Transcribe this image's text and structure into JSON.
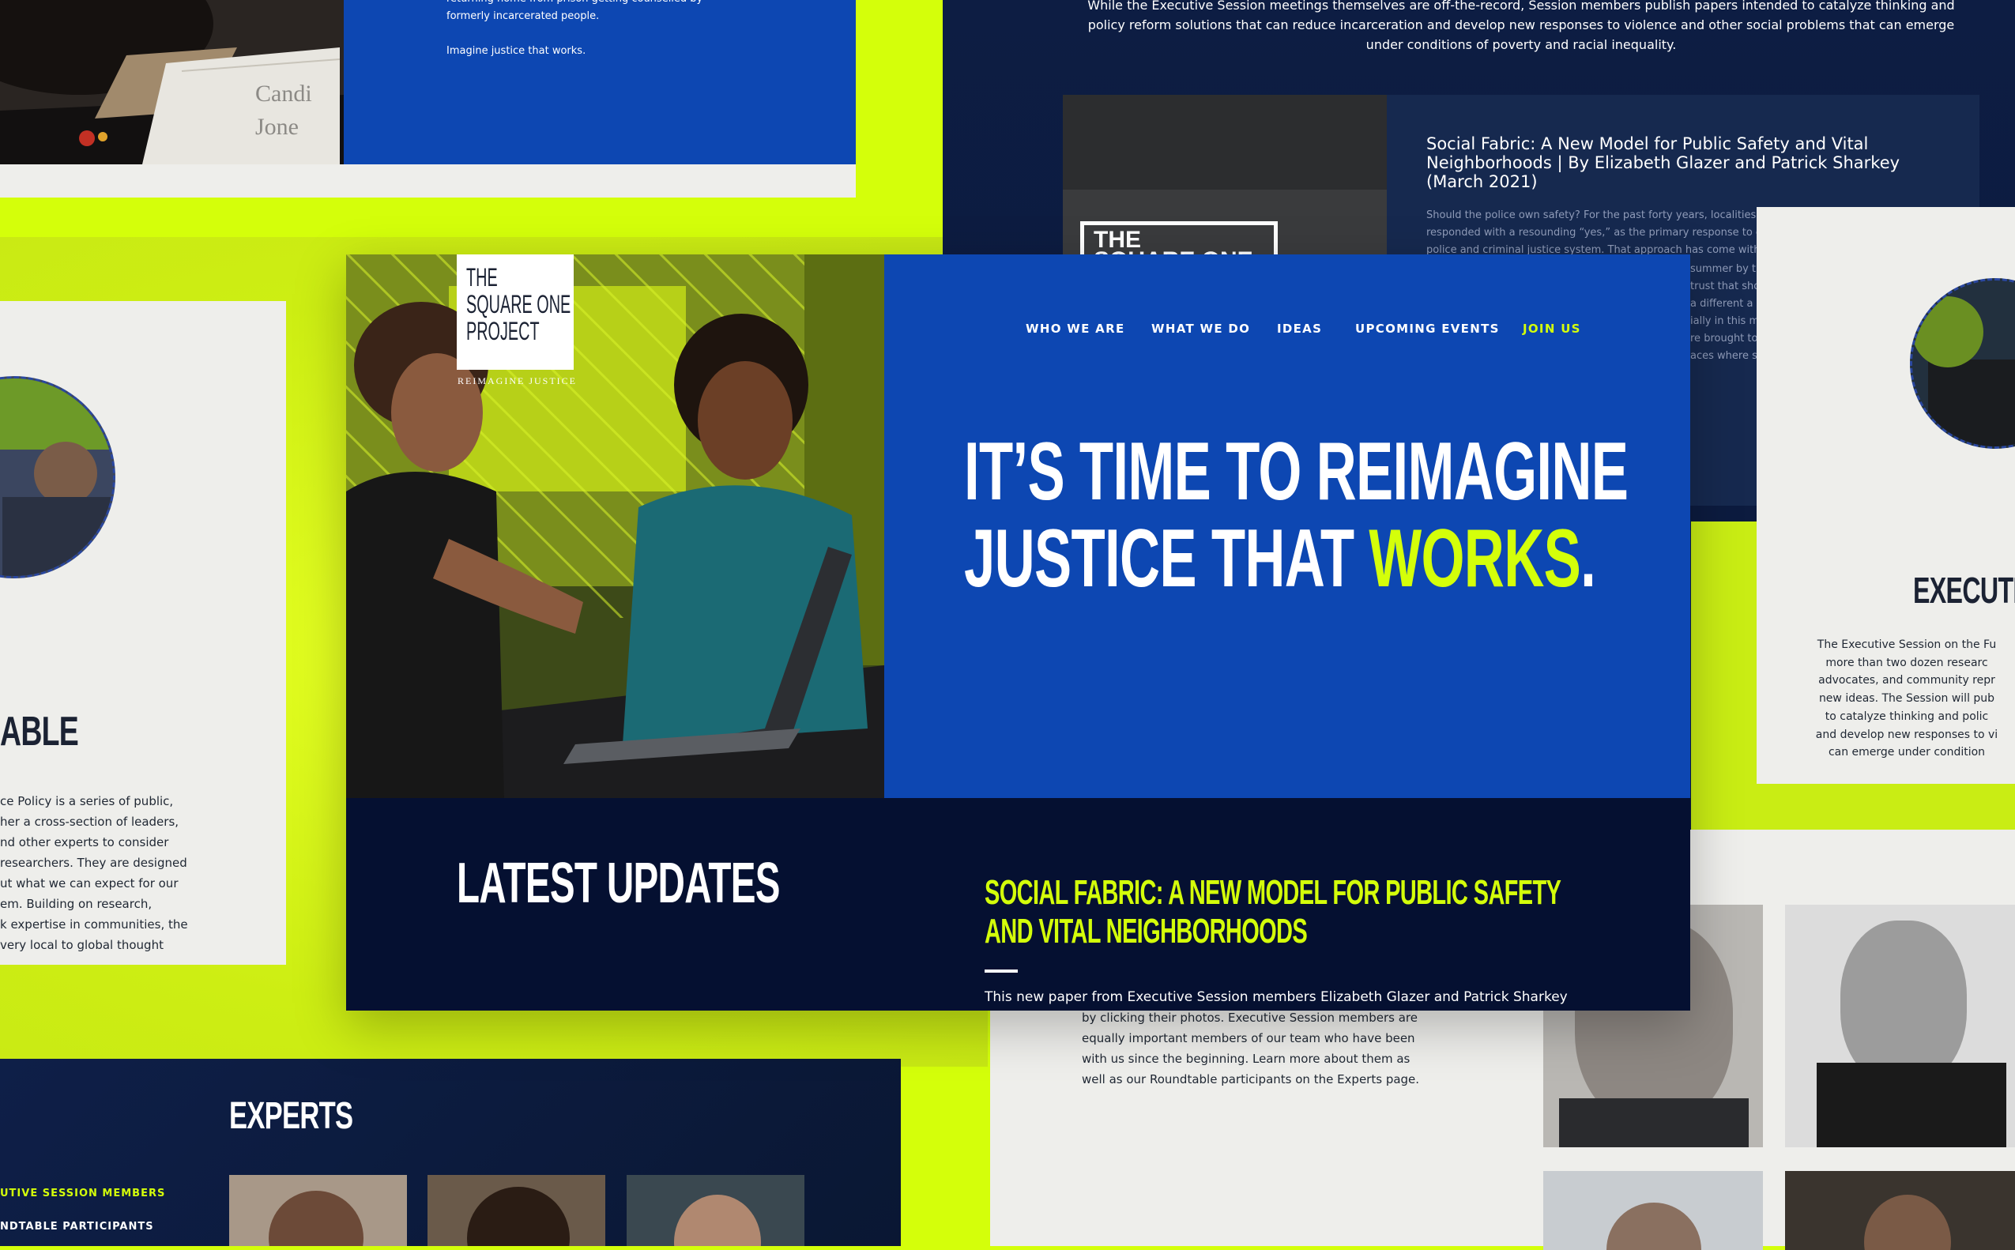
{
  "top_left_card": {
    "text_lines": [
      "returning home from prison getting counselled by",
      "formerly incarcerated people."
    ],
    "tagline": "Imagine justice that works.",
    "nameplate_lines": [
      "Candi",
      "Jone"
    ]
  },
  "top_right_card": {
    "intro_lines": [
      "While the Executive Session meetings themselves are off-the-record, Session members publish papers intended to catalyze thinking and",
      "policy reform solutions that can reduce incarceration and develop new responses to violence and other social problems that can emerge",
      "under conditions of poverty and racial inequality."
    ],
    "article_title_lines": [
      "Social Fabric: A New Model for Public Safety and Vital",
      "Neighborhoods | By Elizabeth Glazer and Patrick Sharkey",
      "(March 2021)"
    ],
    "article_body_lines": [
      "Should the police own safety? For the past forty years, localities",
      "responded with a resounding “yes,” as the primary response to c",
      "police and criminal justice system. That approach has come with"
    ],
    "article_right_fragments": [
      "summer by t",
      "trust that sho",
      "a different a",
      "ially in this m",
      "re brought to",
      "aces where s"
    ],
    "box_label_lines": [
      "THE",
      "SQUARE ONE"
    ]
  },
  "left_card": {
    "heading_fragment": "ABLE",
    "text_lines": [
      "ce Policy is a series of public,",
      "her a cross-section of leaders,",
      "nd other experts to consider",
      "researchers. They are designed",
      "ut what we can expect for our",
      "em. Building on research,",
      "k expertise in communities, the",
      " very local to global thought"
    ]
  },
  "right_card": {
    "heading_fragment": "EXECUTIV",
    "text_lines": [
      "The Executive Session on the Fu",
      "more than two dozen researc",
      "advocates, and community repr",
      "new ideas. The Session will pub",
      "to catalyze thinking and polic",
      "and develop new responses to vi",
      "can emerge under condition"
    ]
  },
  "hero": {
    "logo_lines": [
      "THE",
      "SQUARE ONE",
      "PROJECT"
    ],
    "logo_tagline": "REIMAGINE JUSTICE",
    "nav": [
      "WHO WE ARE",
      "WHAT WE DO",
      "IDEAS",
      "UPCOMING EVENTS",
      "JOIN US"
    ],
    "headline_line1": "IT’S TIME TO REIMAGINE",
    "headline_line2_prefix": "JUSTICE THAT ",
    "headline_highlight": "WORKS",
    "headline_end": ".",
    "latest_updates": "LATEST UPDATES",
    "update_title_lines": [
      "SOCIAL FABRIC: A NEW MODEL FOR PUBLIC SAFETY",
      "AND VITAL NEIGHBORHOODS"
    ],
    "update_excerpt": "This new paper from Executive Session members Elizabeth Glazer and Patrick Sharkey"
  },
  "bottom_middle_card": {
    "text_lines": [
      "by clicking their photos. Executive Session members are",
      "equally important members of our team who have been",
      "with us since the beginning. Learn more about them as",
      "well as our Roundtable participants on the Experts page."
    ]
  },
  "experts_card": {
    "title": "EXPERTS",
    "menu": [
      "UTIVE SESSION MEMBERS",
      "NDTABLE PARTICIPANTS"
    ]
  },
  "colors": {
    "lime": "#d4ff0a",
    "blue": "#0d47b2",
    "navy": "#0b1a3c",
    "deep_navy": "#051031",
    "paper": "#eeeeeb"
  }
}
